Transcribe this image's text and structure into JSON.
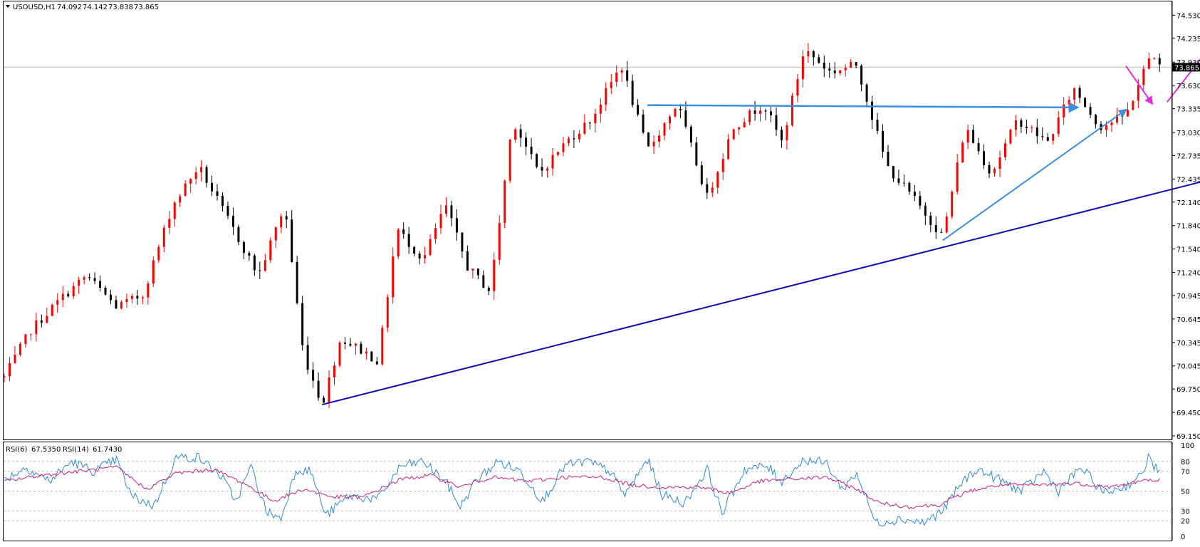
{
  "colors": {
    "up": "#ff0000",
    "down": "#000000",
    "trend_support": "#0d0db3",
    "trend_blue": "#3b8fe0",
    "projection": "#e52ae5",
    "rsi6": "#2f8ad8",
    "rsi14": "#cc1f7a",
    "grid": "#c0c0c0",
    "current_price_bg": "#000000"
  },
  "chart_data": [
    {
      "type": "candlestick",
      "title": "USOUSD,H1",
      "header": {
        "symbol": "USOUSD,H1",
        "open": "74.092",
        "high": "74.142",
        "low": "73.838",
        "close": "73.865"
      },
      "current_price": "73.865",
      "current_price_value": 73.865,
      "ylim": [
        69.15,
        74.67
      ],
      "y_ticks": [
        "74.530",
        "74.235",
        "73.930",
        "73.630",
        "73.335",
        "73.030",
        "72.735",
        "72.435",
        "72.140",
        "71.840",
        "71.540",
        "71.240",
        "70.945",
        "70.645",
        "70.345",
        "70.045",
        "69.750",
        "69.450",
        "69.150"
      ],
      "bars": 218,
      "anchors": [
        [
          0,
          69.9
        ],
        [
          7,
          70.5
        ],
        [
          15,
          70.9
        ],
        [
          22,
          71.2
        ],
        [
          30,
          70.8
        ],
        [
          37,
          70.95
        ],
        [
          45,
          72.1
        ],
        [
          52,
          72.6
        ],
        [
          60,
          71.9
        ],
        [
          68,
          71.2
        ],
        [
          75,
          72.1
        ],
        [
          80,
          70.2
        ],
        [
          85,
          69.55
        ],
        [
          90,
          70.4
        ],
        [
          97,
          70.2
        ],
        [
          100,
          70.1
        ],
        [
          105,
          71.8
        ],
        [
          112,
          71.4
        ],
        [
          118,
          72.1
        ],
        [
          124,
          71.3
        ],
        [
          130,
          71.0
        ],
        [
          136,
          73.2
        ],
        [
          143,
          72.5
        ],
        [
          150,
          72.9
        ],
        [
          157,
          73.2
        ],
        [
          165,
          73.9
        ],
        [
          172,
          72.8
        ],
        [
          180,
          73.4
        ],
        [
          188,
          72.2
        ],
        [
          195,
          73.1
        ],
        [
          203,
          73.4
        ],
        [
          208,
          72.9
        ],
        [
          214,
          74.1
        ],
        [
          221,
          73.8
        ],
        [
          228,
          73.9
        ],
        [
          236,
          72.6
        ],
        [
          243,
          72.2
        ],
        [
          251,
          71.7
        ],
        [
          257,
          73.1
        ],
        [
          264,
          72.5
        ],
        [
          271,
          73.2
        ],
        [
          279,
          72.9
        ],
        [
          286,
          73.6
        ],
        [
          293,
          73.1
        ],
        [
          300,
          73.25
        ],
        [
          307,
          74.08
        ],
        [
          309,
          73.87
        ]
      ],
      "annotations": [
        {
          "kind": "support-trendline",
          "from": [
            85,
            69.55
          ],
          "to": [
            345,
            72.7
          ]
        },
        {
          "kind": "horizontal-resistance",
          "from": [
            172,
            73.38
          ],
          "to": [
            287,
            73.35
          ],
          "arrow": true
        },
        {
          "kind": "rising-trendline",
          "from": [
            251,
            71.65
          ],
          "to": [
            300,
            73.32
          ],
          "arrow": true
        },
        {
          "kind": "projection-down",
          "from": [
            300,
            73.88
          ],
          "to": [
            307,
            73.4
          ],
          "arrow": true
        },
        {
          "kind": "projection-up",
          "from": [
            311,
            73.42
          ],
          "to": [
            330,
            74.58
          ],
          "arrow": true
        }
      ]
    },
    {
      "type": "line",
      "title": "RSI(6) 67.5350 RSI(14) 61.7430",
      "series": [
        {
          "name": "RSI(6)",
          "value_label": "67.5350",
          "color": "#2f8ad8"
        },
        {
          "name": "RSI(14)",
          "value_label": "61.7430",
          "color": "#cc1f7a"
        }
      ],
      "ylim": [
        0,
        100
      ],
      "y_ticks": [
        "100",
        "80",
        "70",
        "50",
        "30",
        "20",
        "0"
      ],
      "levels": [
        80,
        70,
        50,
        30,
        20
      ],
      "rsi6_anchors": [
        [
          0,
          62
        ],
        [
          6,
          74
        ],
        [
          12,
          60
        ],
        [
          18,
          80
        ],
        [
          24,
          70
        ],
        [
          30,
          82
        ],
        [
          34,
          45
        ],
        [
          40,
          35
        ],
        [
          46,
          84
        ],
        [
          52,
          84
        ],
        [
          58,
          65
        ],
        [
          62,
          40
        ],
        [
          66,
          75
        ],
        [
          70,
          30
        ],
        [
          74,
          22
        ],
        [
          78,
          72
        ],
        [
          82,
          70
        ],
        [
          86,
          25
        ],
        [
          92,
          45
        ],
        [
          100,
          42
        ],
        [
          106,
          75
        ],
        [
          112,
          80
        ],
        [
          118,
          60
        ],
        [
          122,
          34
        ],
        [
          126,
          60
        ],
        [
          132,
          80
        ],
        [
          138,
          70
        ],
        [
          144,
          40
        ],
        [
          150,
          76
        ],
        [
          156,
          80
        ],
        [
          162,
          70
        ],
        [
          166,
          46
        ],
        [
          172,
          82
        ],
        [
          176,
          46
        ],
        [
          182,
          38
        ],
        [
          188,
          72
        ],
        [
          192,
          28
        ],
        [
          198,
          72
        ],
        [
          204,
          75
        ],
        [
          208,
          60
        ],
        [
          214,
          82
        ],
        [
          220,
          78
        ],
        [
          224,
          52
        ],
        [
          228,
          68
        ],
        [
          233,
          18
        ],
        [
          240,
          22
        ],
        [
          246,
          18
        ],
        [
          251,
          30
        ],
        [
          256,
          58
        ],
        [
          260,
          72
        ],
        [
          266,
          62
        ],
        [
          272,
          50
        ],
        [
          278,
          70
        ],
        [
          282,
          50
        ],
        [
          288,
          74
        ],
        [
          294,
          48
        ],
        [
          300,
          55
        ],
        [
          304,
          65
        ],
        [
          306,
          84
        ],
        [
          309,
          68
        ]
      ],
      "rsi14_anchors": [
        [
          0,
          60
        ],
        [
          10,
          66
        ],
        [
          20,
          70
        ],
        [
          30,
          74
        ],
        [
          38,
          52
        ],
        [
          46,
          68
        ],
        [
          56,
          72
        ],
        [
          64,
          58
        ],
        [
          72,
          40
        ],
        [
          80,
          52
        ],
        [
          88,
          44
        ],
        [
          96,
          44
        ],
        [
          106,
          62
        ],
        [
          114,
          66
        ],
        [
          122,
          54
        ],
        [
          130,
          64
        ],
        [
          140,
          60
        ],
        [
          150,
          64
        ],
        [
          160,
          64
        ],
        [
          168,
          56
        ],
        [
          176,
          54
        ],
        [
          186,
          54
        ],
        [
          194,
          48
        ],
        [
          202,
          60
        ],
        [
          210,
          62
        ],
        [
          220,
          64
        ],
        [
          228,
          52
        ],
        [
          234,
          38
        ],
        [
          242,
          34
        ],
        [
          250,
          36
        ],
        [
          258,
          50
        ],
        [
          266,
          56
        ],
        [
          276,
          56
        ],
        [
          286,
          58
        ],
        [
          296,
          54
        ],
        [
          304,
          60
        ],
        [
          309,
          62
        ]
      ]
    }
  ]
}
